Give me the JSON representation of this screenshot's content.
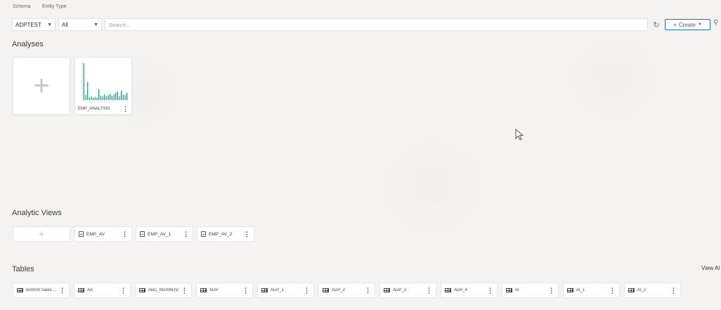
{
  "filters": {
    "schema_label": "Schema",
    "schema_value": "ADPTEST",
    "entity_type_label": "Entity Type",
    "entity_type_value": "All",
    "search_placeholder": "Search..."
  },
  "toolbar": {
    "create_label": "Create"
  },
  "sections": {
    "analyses_title": "Analyses",
    "analytic_views_title": "Analytic Views",
    "tables_title": "Tables",
    "view_all_label": "View Al"
  },
  "analyses": [
    {
      "name": "EMP_ANALYSIS"
    }
  ],
  "analytic_views": [
    {
      "name": "EMP_AV"
    },
    {
      "name": "EMP_AV_1"
    },
    {
      "name": "EMP_AV_2"
    }
  ],
  "tables": [
    {
      "name": "500000 Sales ..."
    },
    {
      "name": "AA"
    },
    {
      "name": "ABC_NOXMLNS"
    },
    {
      "name": "ADP"
    },
    {
      "name": "ADP_1"
    },
    {
      "name": "ADP_2"
    },
    {
      "name": "ADP_3"
    },
    {
      "name": "ADP_4"
    },
    {
      "name": "AI"
    },
    {
      "name": "AI_1"
    },
    {
      "name": "AI_2"
    }
  ],
  "colors": {
    "accent": "#2d6aa8",
    "chart_bar": "#2a9d8f"
  },
  "thumbnail_bars": [
    62,
    8,
    30,
    4,
    6,
    3,
    5,
    4,
    18,
    7,
    6,
    9,
    6,
    8,
    10,
    7,
    9,
    12,
    14,
    6,
    16,
    9,
    8,
    12
  ]
}
